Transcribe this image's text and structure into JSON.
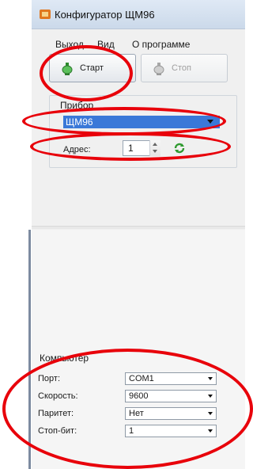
{
  "window": {
    "title": "Конфигуратор ЩМ96"
  },
  "menu": {
    "exit": "Выход",
    "view": "Вид",
    "about": "О программе"
  },
  "toolbar": {
    "start_label": "Старт",
    "stop_label": "Стоп"
  },
  "device_group": {
    "legend": "Прибор",
    "selected_device": "ЩМ96",
    "address_label": "Адрес:",
    "address_value": "1"
  },
  "computer_group": {
    "legend": "Компьютер",
    "port_label": "Порт:",
    "port_value": "COM1",
    "speed_label": "Скорость:",
    "speed_value": "9600",
    "parity_label": "Паритет:",
    "parity_value": "Нет",
    "stopbits_label": "Стоп-бит:",
    "stopbits_value": "1"
  },
  "annotation_color": "#e8000a",
  "icons": [
    "app-icon",
    "start-icon",
    "stop-icon",
    "refresh-icon",
    "chevron-down-icon"
  ]
}
